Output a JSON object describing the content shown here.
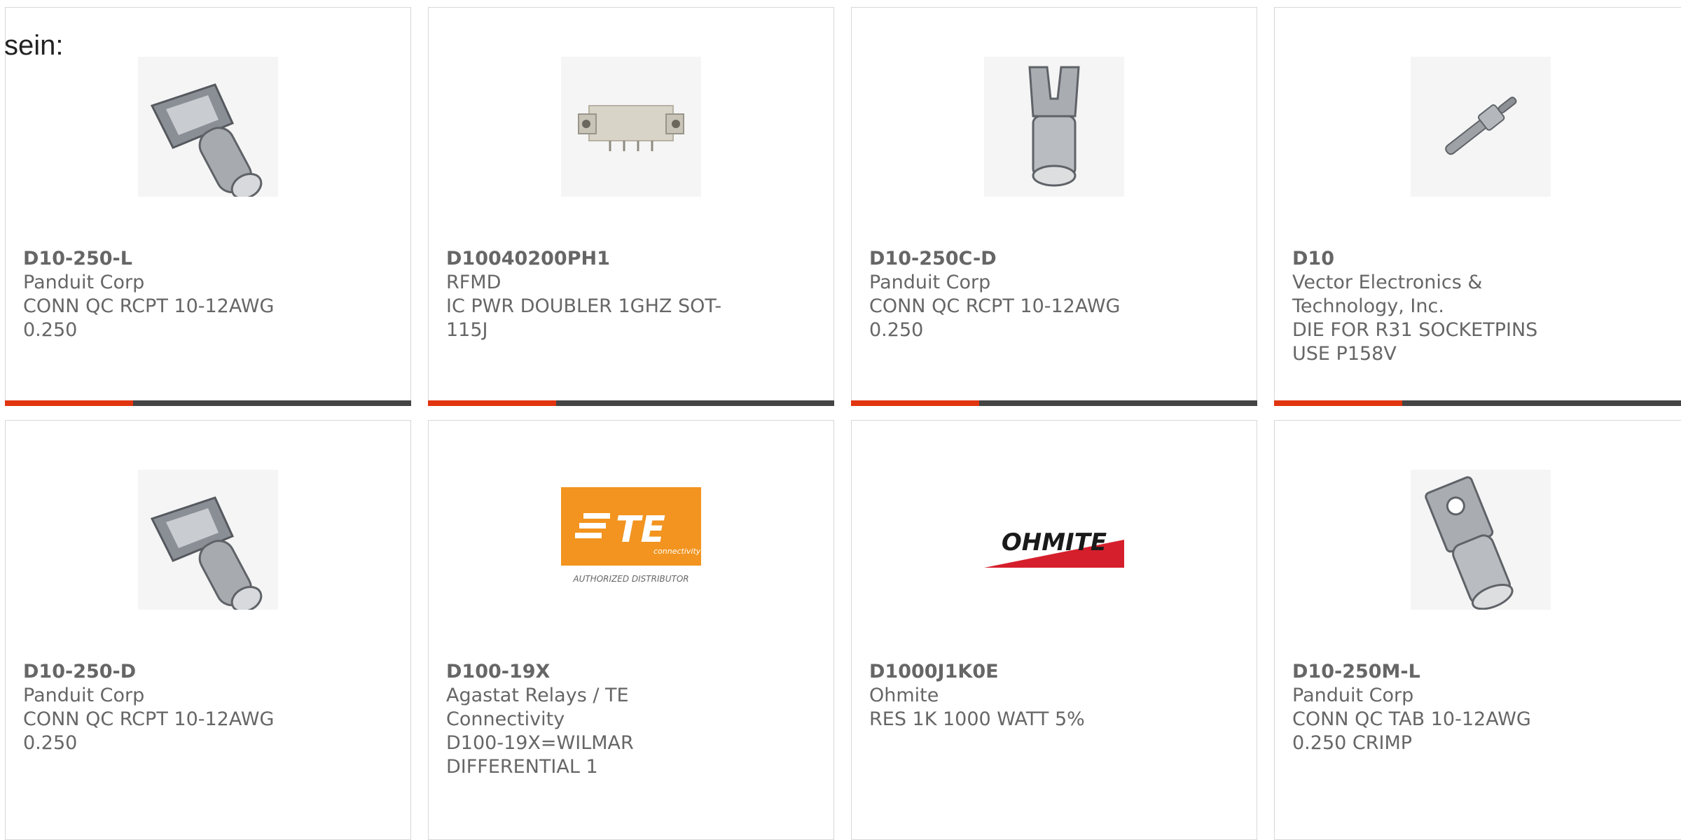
{
  "intro_text": "sein:",
  "colors": {
    "accent": "#e0350f",
    "bar": "#444444",
    "text": "#666666",
    "border": "#d8d8d8"
  },
  "products": [
    {
      "part_number": "D10-250-L",
      "manufacturer": "Panduit Corp",
      "description": "CONN QC RCPT 10-12AWG 0.250",
      "image_icon": "receptacle-terminal-icon"
    },
    {
      "part_number": "D10040200PH1",
      "manufacturer": "RFMD",
      "description": "IC PWR DOUBLER 1GHZ SOT-115J",
      "image_icon": "module-icon"
    },
    {
      "part_number": "D10-250C-D",
      "manufacturer": "Panduit Corp",
      "description": "CONN QC RCPT 10-12AWG 0.250",
      "image_icon": "receptacle-terminal-icon"
    },
    {
      "part_number": "D10",
      "manufacturer": "Vector Electronics & Technology, Inc.",
      "description": "DIE FOR R31 SOCKETPINS USE P158V",
      "image_icon": "pin-die-icon"
    },
    {
      "part_number": "D10-250-D",
      "manufacturer": "Panduit Corp",
      "description": "CONN QC RCPT 10-12AWG 0.250",
      "image_icon": "receptacle-terminal-icon"
    },
    {
      "part_number": "D100-19X",
      "manufacturer": "Agastat Relays / TE Connectivity",
      "description": "D100-19X=WILMAR DIFFERENTIAL 1",
      "image_icon": "te-logo",
      "logo_text": "TE",
      "logo_subtext": "connectivity",
      "logo_caption": "AUTHORIZED DISTRIBUTOR"
    },
    {
      "part_number": "D1000J1K0E",
      "manufacturer": "Ohmite",
      "description": "RES 1K 1000 WATT 5%",
      "image_icon": "ohmite-logo",
      "logo_text": "OHMITE"
    },
    {
      "part_number": "D10-250M-L",
      "manufacturer": "Panduit Corp",
      "description": "CONN QC TAB 10-12AWG 0.250 CRIMP",
      "image_icon": "tab-terminal-icon"
    }
  ]
}
